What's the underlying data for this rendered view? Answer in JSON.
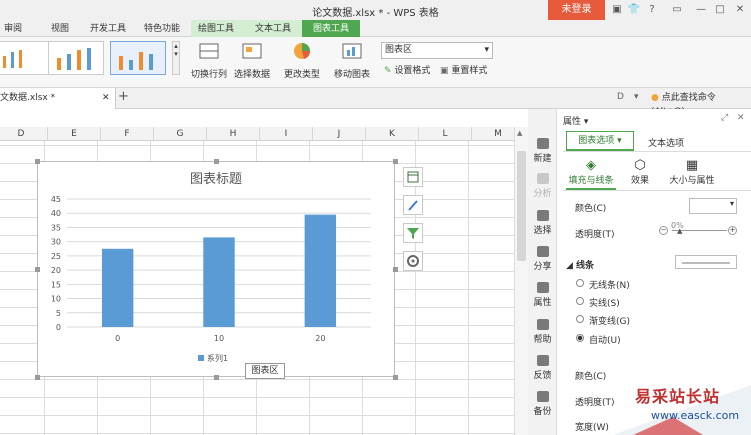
{
  "window": {
    "title": "论文数据.xlsx * - WPS 表格",
    "login_label": "未登录",
    "controls": [
      "▣",
      "👕",
      "?",
      "▭",
      "—",
      "□",
      "✕"
    ]
  },
  "ribbon_tabs": [
    {
      "label": "审阅"
    },
    {
      "label": "视图"
    },
    {
      "label": "开发工具"
    },
    {
      "label": "特色功能"
    },
    {
      "label": "绘图工具"
    },
    {
      "label": "文本工具"
    },
    {
      "label": "图表工具"
    }
  ],
  "ribbon": {
    "switch_row_col": "切换行列",
    "select_data": "选择数据",
    "change_type": "更改类型",
    "move_chart": "移动图表",
    "chart_area_select": "图表区",
    "set_format": "设置格式",
    "reset_style": "重置样式"
  },
  "doc_tab": {
    "name": "文数据.xlsx *",
    "close": "✕",
    "add": "+"
  },
  "find_command": "点此查找命令 (Alt+Q)",
  "columns": [
    "D",
    "E",
    "F",
    "G",
    "H",
    "I",
    "J",
    "K",
    "L",
    "M"
  ],
  "chart_data": {
    "type": "bar",
    "title": "图表标题",
    "categories": [
      "0",
      "10",
      "20"
    ],
    "series": [
      {
        "name": "系列1",
        "values": [
          27.5,
          31.5,
          39.5
        ],
        "color": "#5b9bd5"
      }
    ],
    "ylim": [
      0,
      45
    ],
    "yticks": [
      "0",
      "5",
      "10",
      "15",
      "20",
      "25",
      "30",
      "35",
      "40",
      "45"
    ],
    "grid": true,
    "legend": "bottom"
  },
  "chart_tooltip": "图表区",
  "task_panel": [
    {
      "label": "新建",
      "dim": false
    },
    {
      "label": "分析",
      "dim": true
    },
    {
      "label": "选择",
      "dim": false
    },
    {
      "label": "分享",
      "dim": false
    },
    {
      "label": "属性",
      "dim": false
    },
    {
      "label": "帮助",
      "dim": false
    },
    {
      "label": "反馈",
      "dim": false
    },
    {
      "label": "备份",
      "dim": false
    }
  ],
  "properties": {
    "header": "属性 ▾",
    "tab_chart_options": "图表选项 ▾",
    "tab_text_options": "文本选项",
    "subtab_fill_line": "填充与线条",
    "subtab_effects": "效果",
    "subtab_size": "大小与属性",
    "color_label": "颜色(C)",
    "transparency_label": "透明度(T)",
    "transparency_value": "0%",
    "line_section": "◢ 线条",
    "line_options": [
      "无线条(N)",
      "实线(S)",
      "渐变线(G)",
      "自动(U)"
    ],
    "line_selected": 3,
    "color2_label": "颜色(C)",
    "transparency2_label": "透明度(T)",
    "width_label": "宽度(W)"
  },
  "watermark": {
    "text": "易采站长站",
    "url": "www.easck.com"
  }
}
